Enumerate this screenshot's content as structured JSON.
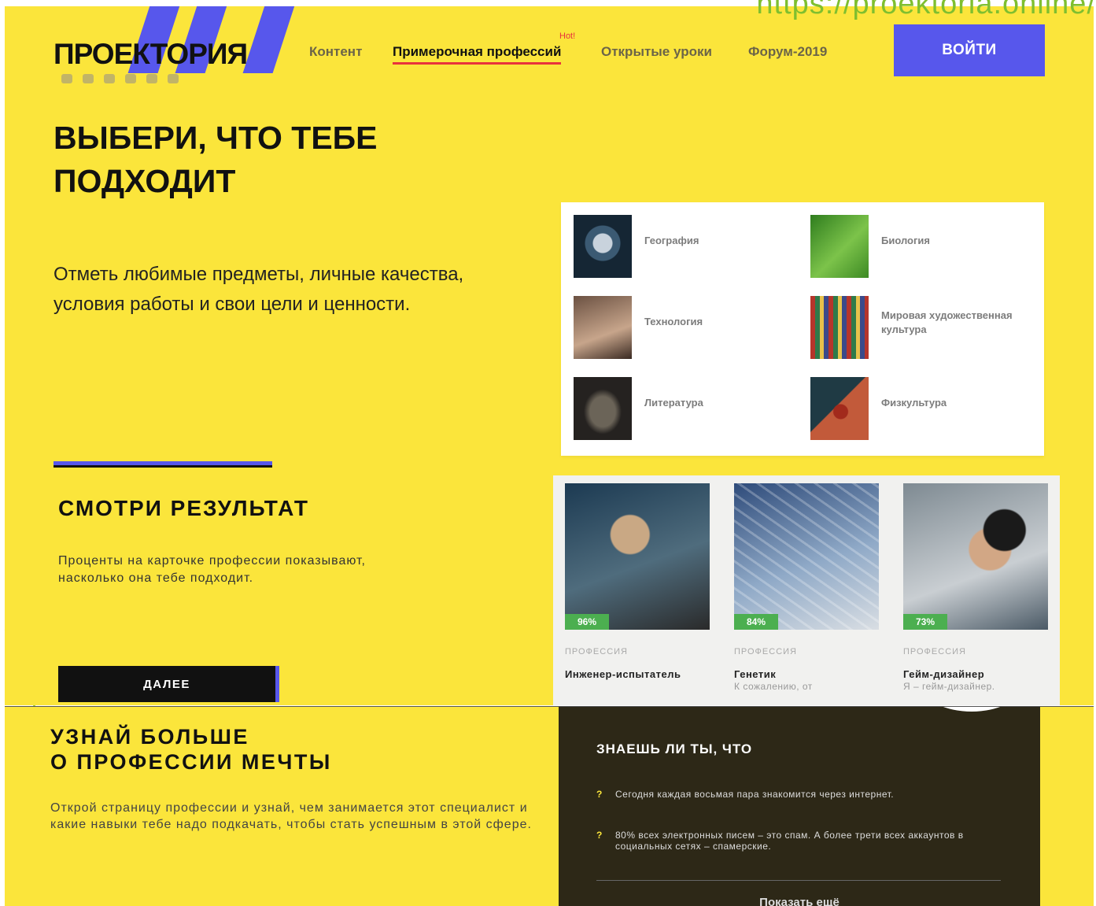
{
  "overlay": {
    "url": "https://proektoria.online/"
  },
  "header": {
    "logo": "ПРОЕКТОРИЯ",
    "social_icons": [
      "vk-icon",
      "ok-icon",
      "instagram-icon",
      "facebook-icon",
      "telegram-icon",
      "youtube-icon"
    ],
    "nav": [
      {
        "label": "Контент",
        "active": false
      },
      {
        "label": "Примерочная профессий",
        "active": true,
        "badge": "Hot!"
      },
      {
        "label": "Открытые уроки",
        "active": false
      },
      {
        "label": "Форум-2019",
        "active": false
      }
    ],
    "login_label": "ВОЙТИ"
  },
  "hero": {
    "title": "ВЫБЕРИ, ЧТО ТЕБЕ ПОДХОДИТ",
    "lead": "Отметь любимые предметы, личные качества, условия работы и свои цели и ценности."
  },
  "subjects": [
    {
      "label": "География",
      "icon": "compass-icon"
    },
    {
      "label": "Биология",
      "icon": "leaf-icon"
    },
    {
      "label": "Технология",
      "icon": "robot-icon"
    },
    {
      "label": "Мировая художественная культура",
      "icon": "books-icon"
    },
    {
      "label": "Литература",
      "icon": "reader-icon"
    },
    {
      "label": "Физкультура",
      "icon": "ball-icon"
    }
  ],
  "results": {
    "title": "СМОТРИ РЕЗУЛЬТАТ",
    "text": "Проценты на карточке профессии показывают, насколько она тебе подходит.",
    "next_label": "ДАЛЕЕ"
  },
  "cards": [
    {
      "pct": "96%",
      "category": "ПРОФЕССИЯ",
      "name": "Инженер-испытатель",
      "desc": ""
    },
    {
      "pct": "84%",
      "category": "ПРОФЕССИЯ",
      "name": "Генетик",
      "desc": "К сожалению, от"
    },
    {
      "pct": "73%",
      "category": "ПРОФЕССИЯ",
      "name": "Гейм-дизайнер",
      "desc": "Я – гейм-дизайнер."
    }
  ],
  "learn_more": {
    "title_line1": "УЗНАЙ БОЛЬШЕ",
    "title_line2": "О ПРОФЕССИИ МЕЧТЫ",
    "text": "Открой страницу профессии и узнай, чем занимается этот специалист и какие навыки тебе надо подкачать, чтобы стать успешным в этой сфере."
  },
  "facts": {
    "title": "ЗНАЕШЬ ЛИ ТЫ, ЧТО",
    "marker": "?",
    "items": [
      "Сегодня каждая восьмая пара знакомится через интернет.",
      "80% всех электронных писем – это спам. А более трети всех аккаунтов в социальных сетях – спамерские."
    ],
    "show_more": "Показать ещё"
  },
  "colors": {
    "yellow": "#fbe53b",
    "accent": "#5757ec",
    "dark": "#2d2817",
    "hot": "#e8323c",
    "badge_green": "#4caf50"
  }
}
